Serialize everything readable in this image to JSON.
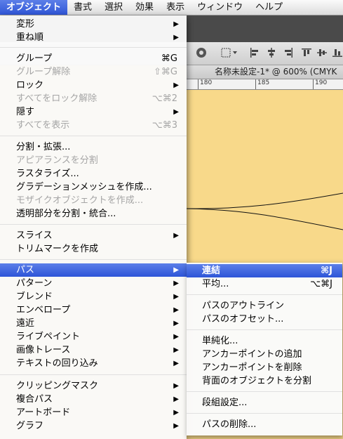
{
  "menubar": {
    "items": [
      "オブジェクト",
      "書式",
      "選択",
      "効果",
      "表示",
      "ウィンドウ",
      "ヘルプ"
    ]
  },
  "document": {
    "tab_title": "名称未設定-1* @ 600% (CMYK",
    "ruler_ticks": [
      "180",
      "185",
      "190"
    ]
  },
  "object_menu": {
    "items": [
      {
        "label": "変形",
        "shortcut": "",
        "submenu": true,
        "disabled": false
      },
      {
        "label": "重ね順",
        "shortcut": "",
        "submenu": true,
        "disabled": false
      },
      {
        "label": "グループ",
        "shortcut": "⌘G",
        "submenu": false,
        "disabled": false
      },
      {
        "label": "グループ解除",
        "shortcut": "⇧⌘G",
        "submenu": false,
        "disabled": true
      },
      {
        "label": "ロック",
        "shortcut": "",
        "submenu": true,
        "disabled": false
      },
      {
        "label": "すべてをロック解除",
        "shortcut": "⌥⌘2",
        "submenu": false,
        "disabled": true
      },
      {
        "label": "隠す",
        "shortcut": "",
        "submenu": true,
        "disabled": false
      },
      {
        "label": "すべてを表示",
        "shortcut": "⌥⌘3",
        "submenu": false,
        "disabled": true
      },
      {
        "label": "分割・拡張...",
        "shortcut": "",
        "submenu": false,
        "disabled": false
      },
      {
        "label": "アピアランスを分割",
        "shortcut": "",
        "submenu": false,
        "disabled": true
      },
      {
        "label": "ラスタライズ...",
        "shortcut": "",
        "submenu": false,
        "disabled": false
      },
      {
        "label": "グラデーションメッシュを作成...",
        "shortcut": "",
        "submenu": false,
        "disabled": false
      },
      {
        "label": "モザイクオブジェクトを作成...",
        "shortcut": "",
        "submenu": false,
        "disabled": true
      },
      {
        "label": "透明部分を分割・統合...",
        "shortcut": "",
        "submenu": false,
        "disabled": false
      },
      {
        "label": "スライス",
        "shortcut": "",
        "submenu": true,
        "disabled": false
      },
      {
        "label": "トリムマークを作成",
        "shortcut": "",
        "submenu": false,
        "disabled": false
      },
      {
        "label": "パス",
        "shortcut": "",
        "submenu": true,
        "disabled": false,
        "selected": true
      },
      {
        "label": "パターン",
        "shortcut": "",
        "submenu": true,
        "disabled": false
      },
      {
        "label": "ブレンド",
        "shortcut": "",
        "submenu": true,
        "disabled": false
      },
      {
        "label": "エンベロープ",
        "shortcut": "",
        "submenu": true,
        "disabled": false
      },
      {
        "label": "遠近",
        "shortcut": "",
        "submenu": true,
        "disabled": false
      },
      {
        "label": "ライブペイント",
        "shortcut": "",
        "submenu": true,
        "disabled": false
      },
      {
        "label": "画像トレース",
        "shortcut": "",
        "submenu": true,
        "disabled": false
      },
      {
        "label": "テキストの回り込み",
        "shortcut": "",
        "submenu": true,
        "disabled": false
      },
      {
        "label": "クリッピングマスク",
        "shortcut": "",
        "submenu": true,
        "disabled": false
      },
      {
        "label": "複合パス",
        "shortcut": "",
        "submenu": true,
        "disabled": false
      },
      {
        "label": "アートボード",
        "shortcut": "",
        "submenu": true,
        "disabled": false
      },
      {
        "label": "グラフ",
        "shortcut": "",
        "submenu": true,
        "disabled": false
      }
    ]
  },
  "path_submenu": {
    "items": [
      {
        "label": "連結",
        "shortcut": "⌘J",
        "selected": true
      },
      {
        "label": "平均...",
        "shortcut": "⌥⌘J"
      },
      {
        "label": "パスのアウトライン",
        "shortcut": ""
      },
      {
        "label": "パスのオフセット...",
        "shortcut": ""
      },
      {
        "label": "単純化...",
        "shortcut": ""
      },
      {
        "label": "アンカーポイントの追加",
        "shortcut": ""
      },
      {
        "label": "アンカーポイントを削除",
        "shortcut": ""
      },
      {
        "label": "背面のオブジェクトを分割",
        "shortcut": ""
      },
      {
        "label": "段組設定...",
        "shortcut": ""
      },
      {
        "label": "パスの削除...",
        "shortcut": ""
      }
    ]
  },
  "colors": {
    "selection": "#2f55d6",
    "canvas": "#f8d98a",
    "disabled_text": "#a5a5a5"
  }
}
